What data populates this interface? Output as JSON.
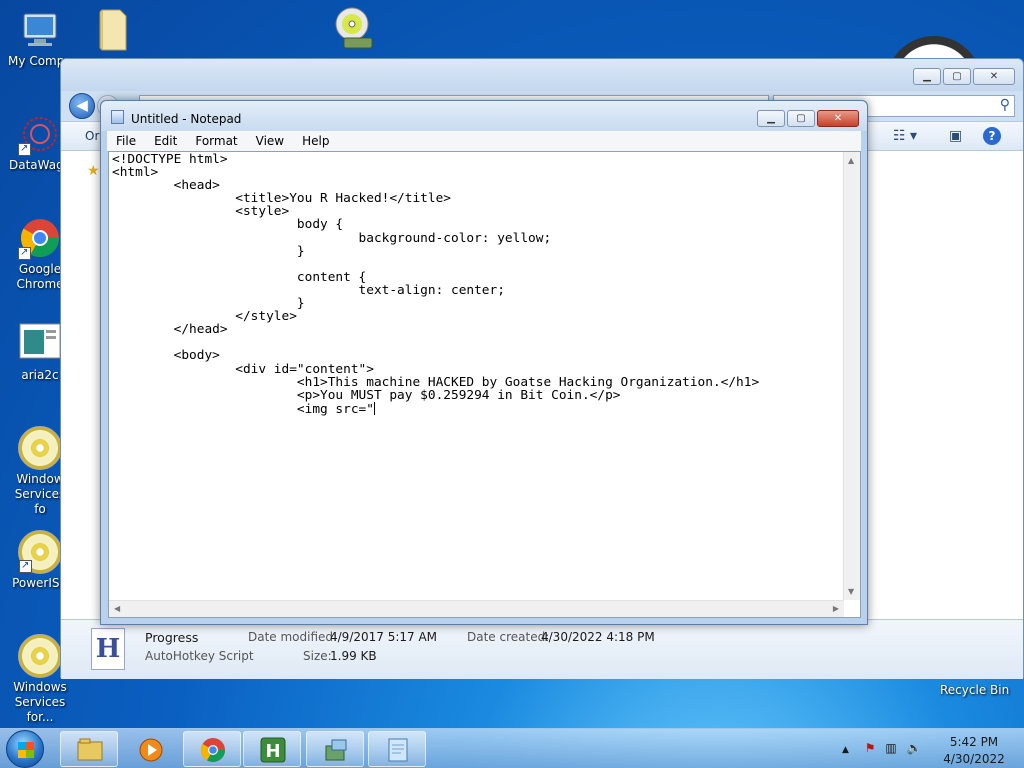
{
  "desktop": {
    "icons": [
      {
        "label": "My Compu",
        "icon": "computer-icon"
      },
      {
        "label": "DataWago",
        "icon": "datawago-icon"
      },
      {
        "label": "Google Chrome",
        "icon": "chrome-icon"
      },
      {
        "label": "aria2c",
        "icon": "aria2c-icon"
      },
      {
        "label": "Window Services fo",
        "icon": "disc-icon"
      },
      {
        "label": "PowerISC",
        "icon": "disc-icon"
      },
      {
        "label": "Windows Services for...",
        "icon": "disc-icon"
      }
    ],
    "recycle_bin": "Recycle Bin"
  },
  "explorer": {
    "toolbar_organize": "Or",
    "details": {
      "file_name": "Progress",
      "file_type": "AutoHotkey Script",
      "modified_label": "Date modified:",
      "modified_value": "4/9/2017 5:17 AM",
      "created_label": "Date created:",
      "created_value": "4/30/2022 4:18 PM",
      "size_label": "Size:",
      "size_value": "1.99 KB"
    }
  },
  "notepad": {
    "title": "Untitled - Notepad",
    "menu": [
      "File",
      "Edit",
      "Format",
      "View",
      "Help"
    ],
    "content": "<!DOCTYPE html>\n<html>\n        <head>\n                <title>You R Hacked!</title>\n                <style>\n                        body {\n                                background-color: yellow;\n                        }\n\n                        content {\n                                text-align: center;\n                        }\n                </style>\n        </head>\n\n        <body>\n                <div id=\"content\">\n                        <h1>This machine HACKED by Goatse Hacking Organization.</h1>\n                        <p>You MUST pay $0.259294 in Bit Coin.</p>\n                        <img src=\""
  },
  "taskbar": {
    "time": "5:42 PM",
    "date": "4/30/2022",
    "buttons": [
      "explorer",
      "media-player",
      "chrome",
      "autohotkey",
      "installer",
      "notepad"
    ]
  }
}
